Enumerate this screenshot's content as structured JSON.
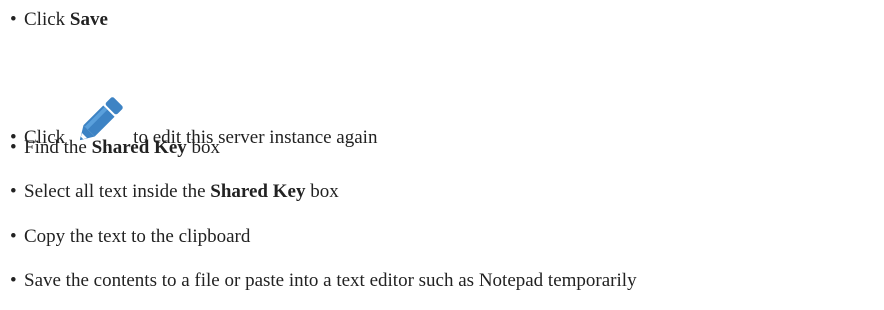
{
  "steps": [
    {
      "prefix": "Click ",
      "bold": "Save",
      "suffix": ""
    },
    {
      "prefix": "Click",
      "icon": "pencil-edit-icon",
      "suffix": "to edit this server instance again"
    },
    {
      "prefix": "Find the ",
      "bold": "Shared Key",
      "suffix": " box"
    },
    {
      "prefix": "Select all text inside the ",
      "bold": "Shared Key",
      "suffix": " box"
    },
    {
      "prefix": "Copy the text to the clipboard"
    },
    {
      "prefix": "Save the contents to a file or paste into a text editor such as Notepad temporarily"
    }
  ],
  "bullet": "•",
  "colors": {
    "text": "#222222",
    "icon": "#3d83c4",
    "icon_light": "#5aa0dc"
  }
}
